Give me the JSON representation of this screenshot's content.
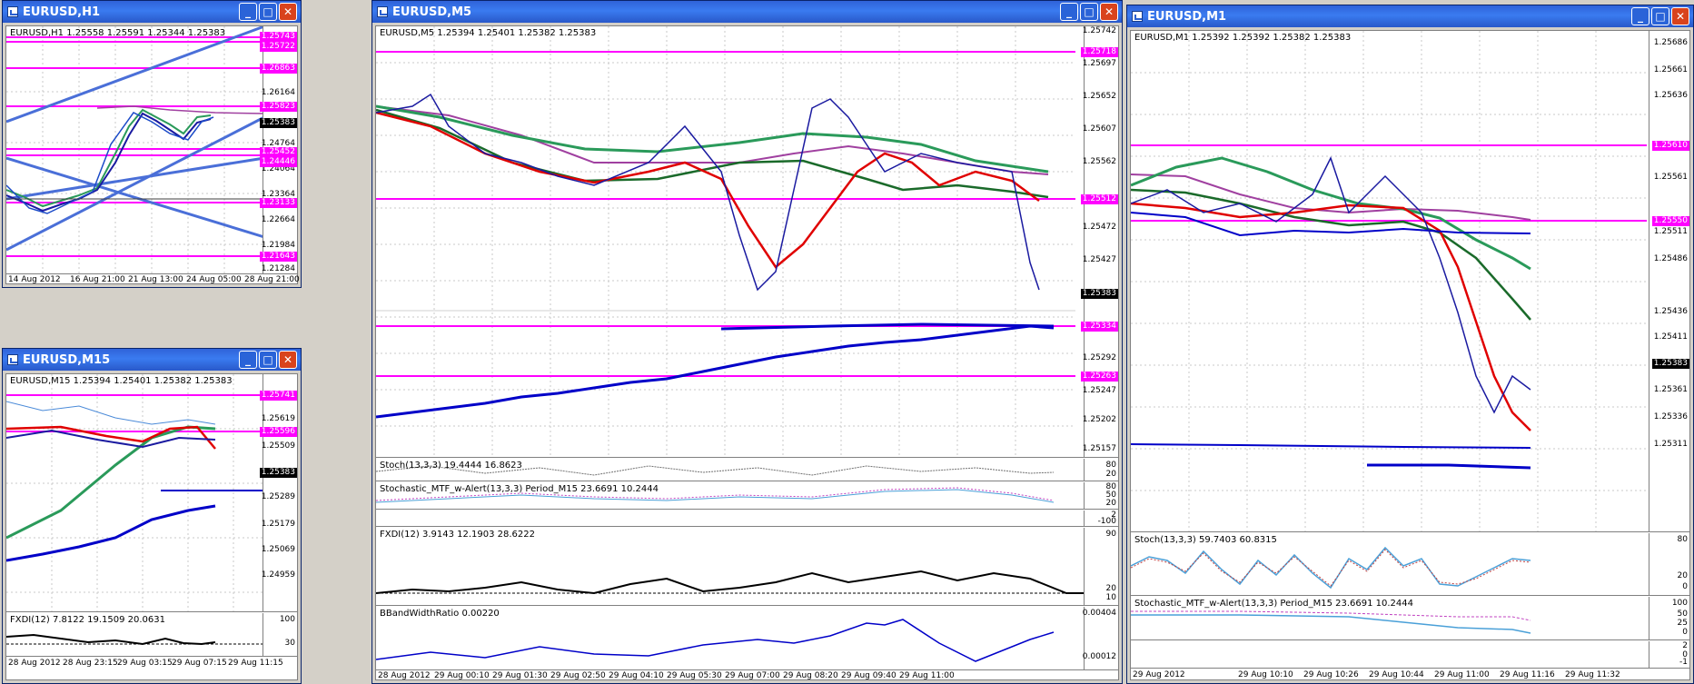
{
  "windows": {
    "h1": {
      "title": "EURUSD,H1",
      "header": "EURUSD,H1  1.25558 1.25591 1.25344 1.25383",
      "prices": [
        "1.26164",
        "1.24764",
        "1.24064",
        "1.23364",
        "1.22664",
        "1.21984",
        "1.21284"
      ],
      "tags": [
        "1.25743",
        "1.25722",
        "1.26863",
        "1.25823",
        "1.25452",
        "1.24446",
        "1.23133",
        "1.21643"
      ],
      "current": "1.25383",
      "times": [
        "14 Aug 2012",
        "16 Aug 21:00",
        "21 Aug 13:00",
        "24 Aug 05:00",
        "28 Aug 21:00"
      ]
    },
    "m15": {
      "title": "EURUSD,M15",
      "header": "EURUSD,M15  1.25394 1.25401 1.25382 1.25383",
      "prices": [
        "1.25619",
        "1.25509",
        "1.25289",
        "1.25179",
        "1.25069",
        "1.24959"
      ],
      "tags": [
        "1.25741",
        "1.25596"
      ],
      "current": "1.25383",
      "ind_header": "FXDI(12) 7.8122 19.1509 20.0631",
      "ind_scale": [
        "100",
        "30"
      ],
      "times": [
        "28 Aug 2012",
        "28 Aug 23:15",
        "29 Aug 03:15",
        "29 Aug 07:15",
        "29 Aug 11:15"
      ]
    },
    "m5": {
      "title": "EURUSD,M5",
      "header": "EURUSD,M5  1.25394 1.25401 1.25382 1.25383",
      "prices": [
        "1.25742",
        "1.25697",
        "1.25652",
        "1.25607",
        "1.25562",
        "1.25472",
        "1.25427",
        "1.25337",
        "1.25292",
        "1.25247",
        "1.25202",
        "1.25157"
      ],
      "tags": [
        "1.25718",
        "1.25512",
        "1.25334",
        "1.25263"
      ],
      "current": "1.25383",
      "stoch_header": "Stoch(13,3,3) 19.4444 16.8623",
      "stoch_scale": [
        "80",
        "20"
      ],
      "mtf_header": "Stochastic_MTF_w-Alert(13,3,3) Period_M15 23.6691 10.2444",
      "mtf_scale": [
        "80",
        "50",
        "20"
      ],
      "extra_scale": [
        "2",
        "-100"
      ],
      "fxdi_header": "FXDI(12) 3.9143 12.1903 28.6222",
      "fxdi_scale": [
        "90",
        "20",
        "10"
      ],
      "bb_header": "BBandWidthRatio 0.00220",
      "bb_scale": [
        "0.00404",
        "0.00012"
      ],
      "times": [
        "28 Aug 2012",
        "29 Aug 00:10",
        "29 Aug 01:30",
        "29 Aug 02:50",
        "29 Aug 04:10",
        "29 Aug 05:30",
        "29 Aug 07:00",
        "29 Aug 08:20",
        "29 Aug 09:40",
        "29 Aug 11:00"
      ]
    },
    "m1": {
      "title": "EURUSD,M1",
      "header": "EURUSD,M1  1.25392 1.25392 1.25382 1.25383",
      "prices": [
        "1.25686",
        "1.25661",
        "1.25636",
        "1.25586",
        "1.25561",
        "1.25511",
        "1.25486",
        "1.25436",
        "1.25411",
        "1.25361",
        "1.25336",
        "1.25311"
      ],
      "tags": [
        "1.25610",
        "1.25550"
      ],
      "current": "1.25383",
      "stoch_header": "Stoch(13,3,3) 59.7403 60.8315",
      "stoch_scale": [
        "80",
        "20",
        "0"
      ],
      "mtf_header": "Stochastic_MTF_w-Alert(13,3,3) Period_M15 23.6691 10.2444",
      "mtf_scale": [
        "100",
        "50",
        "25",
        "0"
      ],
      "extra_scale": [
        "2",
        "0",
        "-1"
      ],
      "times": [
        "29 Aug 2012",
        "29 Aug 10:10",
        "29 Aug 10:26",
        "29 Aug 10:44",
        "29 Aug 11:00",
        "29 Aug 11:16",
        "29 Aug 11:32"
      ]
    }
  },
  "buttons": {
    "minimize": "_",
    "maximize": "□",
    "close": "✕"
  },
  "colors": {
    "magenta": "#ff00ff",
    "blue": "#0000c8",
    "red": "#e00000",
    "green": "#2a9a5a",
    "titlebar": "#2f63d9"
  }
}
